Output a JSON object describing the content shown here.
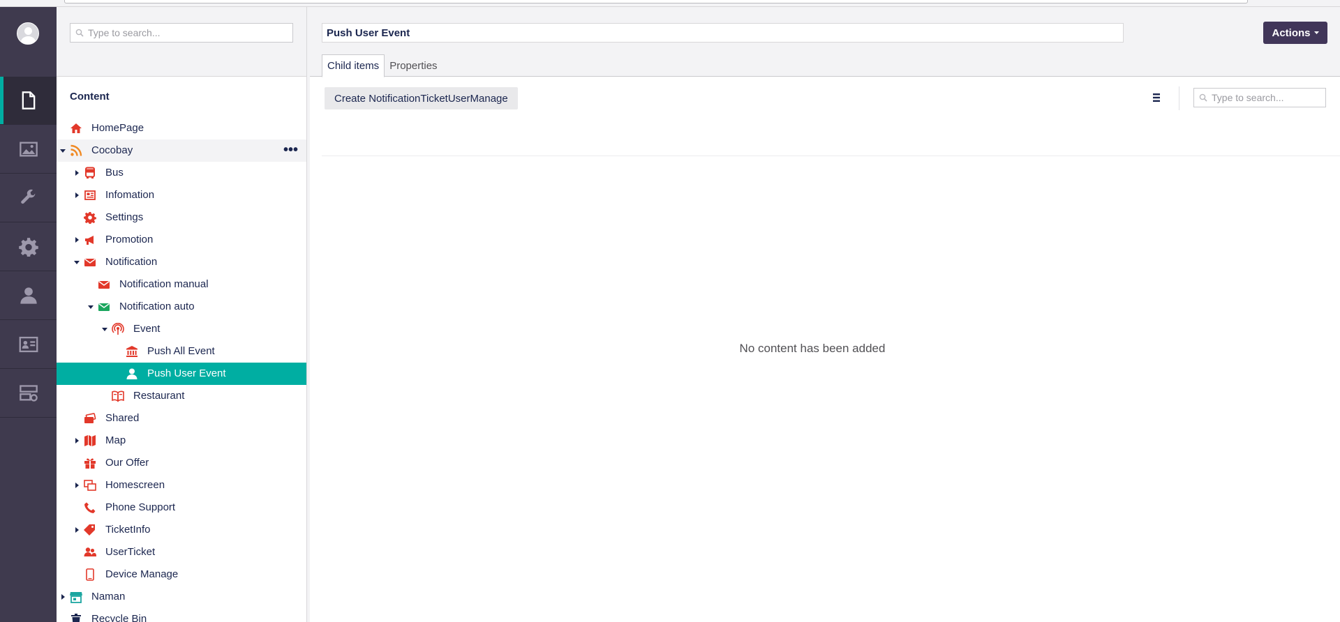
{
  "colors": {
    "appbar": "#3f3a4e",
    "accent": "#00aea2",
    "actions_button": "#413659",
    "icon_red": "#e2382a",
    "icon_green": "#1ba65e",
    "icon_orange": "#f08a24",
    "icon_teal": "#1ba6a0"
  },
  "sections": [
    {
      "name": "content",
      "icon": "document-icon",
      "active": true
    },
    {
      "name": "media",
      "icon": "picture-icon",
      "active": false
    },
    {
      "name": "settings",
      "icon": "wrench-icon",
      "active": false
    },
    {
      "name": "developer",
      "icon": "gear-icon",
      "active": false
    },
    {
      "name": "users",
      "icon": "user-icon",
      "active": false
    },
    {
      "name": "members",
      "icon": "id-card-icon",
      "active": false
    },
    {
      "name": "forms",
      "icon": "form-icon",
      "active": false
    }
  ],
  "tree": {
    "search_placeholder": "Type to search...",
    "title": "Content",
    "items": [
      {
        "label": "HomePage",
        "level": 0,
        "icon": "home-icon",
        "expander": "none",
        "state": ""
      },
      {
        "label": "Cocobay",
        "level": 0,
        "icon": "rss-icon",
        "expander": "open",
        "state": "hover",
        "menu": "•••"
      },
      {
        "label": "Bus",
        "level": 1,
        "icon": "bus-icon",
        "expander": "closed",
        "state": ""
      },
      {
        "label": "Infomation",
        "level": 1,
        "icon": "newspaper-icon",
        "expander": "closed",
        "state": ""
      },
      {
        "label": "Settings",
        "level": 1,
        "icon": "cog-icon",
        "expander": "none",
        "state": ""
      },
      {
        "label": "Promotion",
        "level": 1,
        "icon": "megaphone-icon",
        "expander": "closed",
        "state": ""
      },
      {
        "label": "Notification",
        "level": 1,
        "icon": "envelope-icon",
        "expander": "open",
        "state": ""
      },
      {
        "label": "Notification manual",
        "level": 2,
        "icon": "envelope-icon",
        "expander": "none",
        "state": ""
      },
      {
        "label": "Notification auto",
        "level": 2,
        "icon": "envelope-green-icon",
        "expander": "open",
        "state": ""
      },
      {
        "label": "Event",
        "level": 3,
        "icon": "broadcast-icon",
        "expander": "open",
        "state": ""
      },
      {
        "label": "Push All Event",
        "level": 4,
        "icon": "bank-icon",
        "expander": "none",
        "state": ""
      },
      {
        "label": "Push User Event",
        "level": 4,
        "icon": "user-icon",
        "expander": "none",
        "state": "selected"
      },
      {
        "label": "Restaurant",
        "level": 3,
        "icon": "menu-book-icon",
        "expander": "none",
        "state": ""
      },
      {
        "label": "Shared",
        "level": 1,
        "icon": "ticket-stack-icon",
        "expander": "none",
        "state": ""
      },
      {
        "label": "Map",
        "level": 1,
        "icon": "map-icon",
        "expander": "closed",
        "state": ""
      },
      {
        "label": "Our Offer",
        "level": 1,
        "icon": "gift-icon",
        "expander": "none",
        "state": ""
      },
      {
        "label": "Homescreen",
        "level": 1,
        "icon": "windows-icon",
        "expander": "closed",
        "state": ""
      },
      {
        "label": "Phone Support",
        "level": 1,
        "icon": "phone-icon",
        "expander": "none",
        "state": ""
      },
      {
        "label": "TicketInfo",
        "level": 1,
        "icon": "tags-icon",
        "expander": "closed",
        "state": ""
      },
      {
        "label": "UserTicket",
        "level": 1,
        "icon": "users-icon",
        "expander": "none",
        "state": ""
      },
      {
        "label": "Device Manage",
        "level": 1,
        "icon": "mobile-icon",
        "expander": "none",
        "state": ""
      },
      {
        "label": "Naman",
        "level": 0,
        "icon": "store-icon",
        "expander": "closed",
        "state": ""
      },
      {
        "label": "Recycle Bin",
        "level": 0,
        "icon": "trash-icon",
        "expander": "none",
        "state": ""
      }
    ]
  },
  "main": {
    "node_name": "Push User Event",
    "actions_label": "Actions",
    "tabs": [
      {
        "label": "Child items",
        "active": true
      },
      {
        "label": "Properties",
        "active": false
      }
    ],
    "create_button": "Create NotificationTicketUserManage",
    "search_placeholder": "Type to search...",
    "empty_message": "No content has been added"
  }
}
